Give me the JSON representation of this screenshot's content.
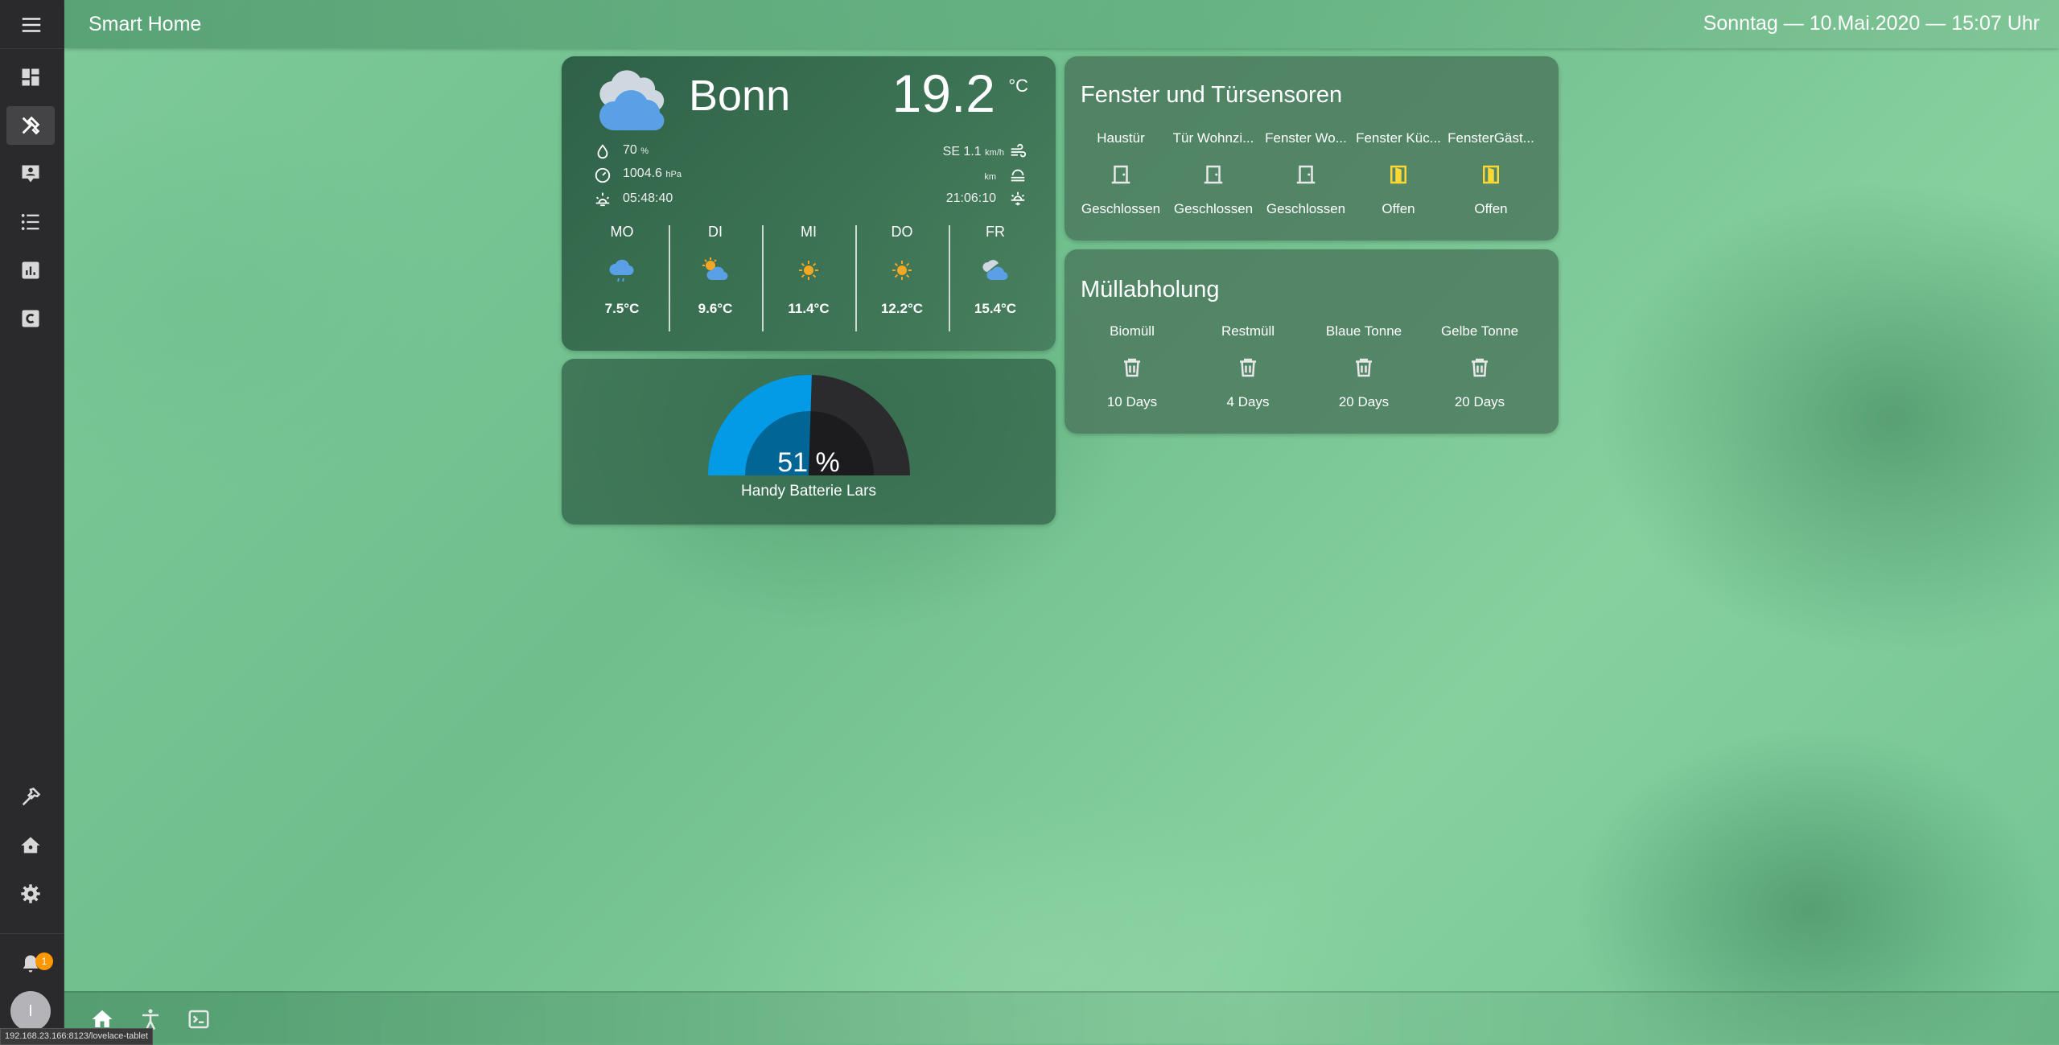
{
  "header": {
    "title": "Smart Home",
    "datetime": "Sonntag — 10.Mai.2020 — 15:07 Uhr"
  },
  "sidebar": {
    "items": [
      {
        "icon": "dashboard-icon",
        "active": false
      },
      {
        "icon": "tools-icon",
        "active": true
      },
      {
        "icon": "account-box-icon",
        "active": false
      },
      {
        "icon": "format-list-icon",
        "active": false
      },
      {
        "icon": "chart-bar-icon",
        "active": false
      },
      {
        "icon": "alpha-c-box-icon",
        "active": false
      }
    ],
    "bottom_items": [
      {
        "icon": "hammer-icon"
      },
      {
        "icon": "home-assistant-icon"
      },
      {
        "icon": "gear-icon"
      }
    ],
    "notification_count": "1",
    "user_initial": "I"
  },
  "weather": {
    "city": "Bonn",
    "temperature": "19.2",
    "unit": "°C",
    "humidity": "70",
    "humidity_unit": "%",
    "pressure": "1004.6",
    "pressure_unit": "hPa",
    "sunrise": "05:48:40",
    "wind": "SE 1.1",
    "wind_unit": "km/h",
    "visibility_unit": "km",
    "sunset": "21:06:10",
    "forecast": [
      {
        "day": "MO",
        "temp": "7.5°C",
        "icon": "rainy-icon"
      },
      {
        "day": "DI",
        "temp": "9.6°C",
        "icon": "partly-cloudy-icon"
      },
      {
        "day": "MI",
        "temp": "11.4°C",
        "icon": "sunny-icon"
      },
      {
        "day": "DO",
        "temp": "12.2°C",
        "icon": "sunny-icon"
      },
      {
        "day": "FR",
        "temp": "15.4°C",
        "icon": "partly-cloudy-icon"
      }
    ]
  },
  "battery": {
    "value": "51 %",
    "percent": 51,
    "name": "Handy Batterie Lars",
    "color": "#039be5"
  },
  "doors": {
    "title": "Fenster und Türsensoren",
    "items": [
      {
        "name": "Haustür",
        "state": "Geschlossen",
        "open": false
      },
      {
        "name": "Tür Wohnzi...",
        "state": "Geschlossen",
        "open": false
      },
      {
        "name": "Fenster Wo...",
        "state": "Geschlossen",
        "open": false
      },
      {
        "name": "Fenster Küc...",
        "state": "Offen",
        "open": true
      },
      {
        "name": "FensterGäst...",
        "state": "Offen",
        "open": true
      }
    ],
    "open_color": "#fdd835"
  },
  "trash": {
    "title": "Müllabholung",
    "items": [
      {
        "name": "Biomüll",
        "state": "10 Days"
      },
      {
        "name": "Restmüll",
        "state": "4 Days"
      },
      {
        "name": "Blaue Tonne",
        "state": "20 Days"
      },
      {
        "name": "Gelbe Tonne",
        "state": "20 Days"
      }
    ]
  },
  "footer": {
    "tabs": [
      {
        "icon": "home-icon"
      },
      {
        "icon": "human-icon"
      },
      {
        "icon": "console-icon"
      }
    ],
    "status_url": "192.168.23.166:8123/lovelace-tablet"
  }
}
